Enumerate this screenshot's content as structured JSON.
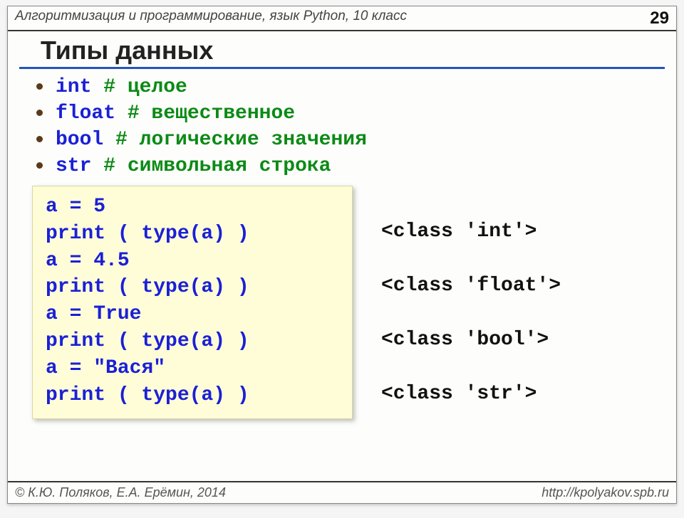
{
  "header": {
    "title": "Алгоритмизация и программирование, язык Python, 10 класс",
    "page": "29"
  },
  "section_title": "Типы данных",
  "types": [
    {
      "keyword": "int",
      "pad": "    ",
      "comment": "# целое"
    },
    {
      "keyword": "float",
      "pad": "  ",
      "comment": "# вещественное"
    },
    {
      "keyword": "bool",
      "pad": "     ",
      "comment": "# логические значения"
    },
    {
      "keyword": "str",
      "pad": "  ",
      "comment": "# символьная строка"
    }
  ],
  "code": {
    "lines": [
      "a = 5",
      "print ( type(a) )",
      "a = 4.5",
      "print ( type(a) )",
      "a = True",
      "print ( type(a) )",
      "a = \"Вася\"",
      "print ( type(a) )"
    ]
  },
  "outputs": [
    "<class 'int'>",
    "",
    "<class 'float'>",
    "",
    "<class 'bool'>",
    "",
    "<class 'str'>"
  ],
  "footer": {
    "left": "© К.Ю. Поляков, Е.А. Ерёмин, 2014",
    "right": "http://kpolyakov.spb.ru"
  }
}
